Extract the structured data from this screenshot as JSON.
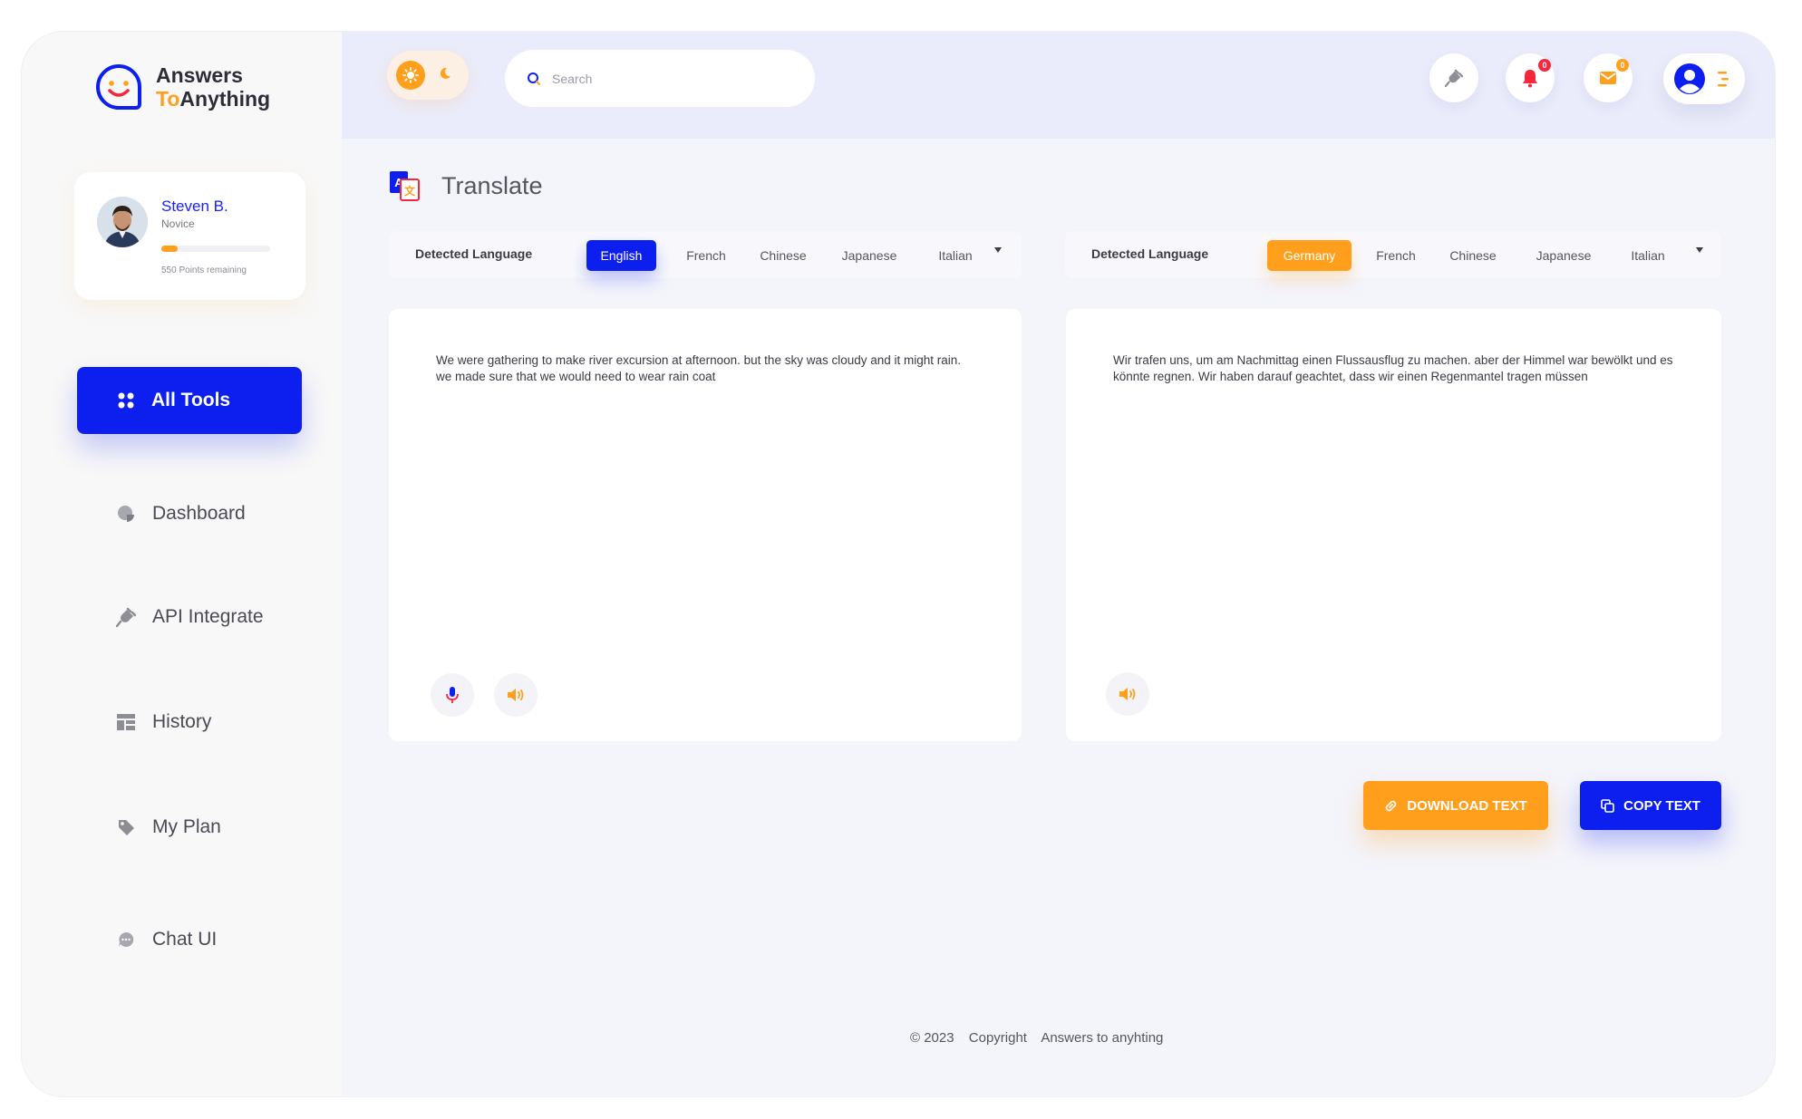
{
  "brand": {
    "line1": "Answers",
    "line2_accent": "To",
    "line2_rest": "Anything"
  },
  "profile": {
    "name": "Steven B.",
    "role": "Novice",
    "points_text": "550 Points remaining",
    "progress_fraction": 0.15
  },
  "sidebar": {
    "primary_label": "All Tools",
    "items": [
      {
        "label": "Dashboard",
        "icon": "pie-chart-icon"
      },
      {
        "label": "API Integrate",
        "icon": "plug-icon"
      },
      {
        "label": "History",
        "icon": "layout-icon"
      },
      {
        "label": "My Plan",
        "icon": "tag-icon"
      },
      {
        "label": "Chat UI",
        "icon": "chat-bubble-icon"
      }
    ]
  },
  "header": {
    "search_placeholder": "Search",
    "notifications_count": "0",
    "messages_count": "0"
  },
  "page": {
    "title": "Translate"
  },
  "source": {
    "detected_label": "Detected Language",
    "languages": [
      "English",
      "French",
      "Chinese",
      "Japanese",
      "Italian"
    ],
    "selected": "English",
    "text": "We were gathering to make river excursion at afternoon. but the sky was cloudy and it might rain. we made sure that we would need to wear rain coat"
  },
  "target": {
    "detected_label": "Detected Language",
    "languages": [
      "Germany",
      "French",
      "Chinese",
      "Japanese",
      "Italian"
    ],
    "selected": "Germany",
    "text": "Wir trafen uns, um am Nachmittag einen Flussausflug zu machen. aber der Himmel war bewölkt und es könnte regnen. Wir haben darauf geachtet, dass wir einen Regenmantel tragen müssen"
  },
  "actions": {
    "download_label": "DOWNLOAD TEXT",
    "copy_label": "COPY TEXT"
  },
  "footer": {
    "year": "© 2023",
    "copyright": "Copyright",
    "owner": "Answers to anyhting"
  },
  "colors": {
    "primary": "#0d1fef",
    "accent": "#ff9f1c",
    "danger": "#f5273c"
  }
}
